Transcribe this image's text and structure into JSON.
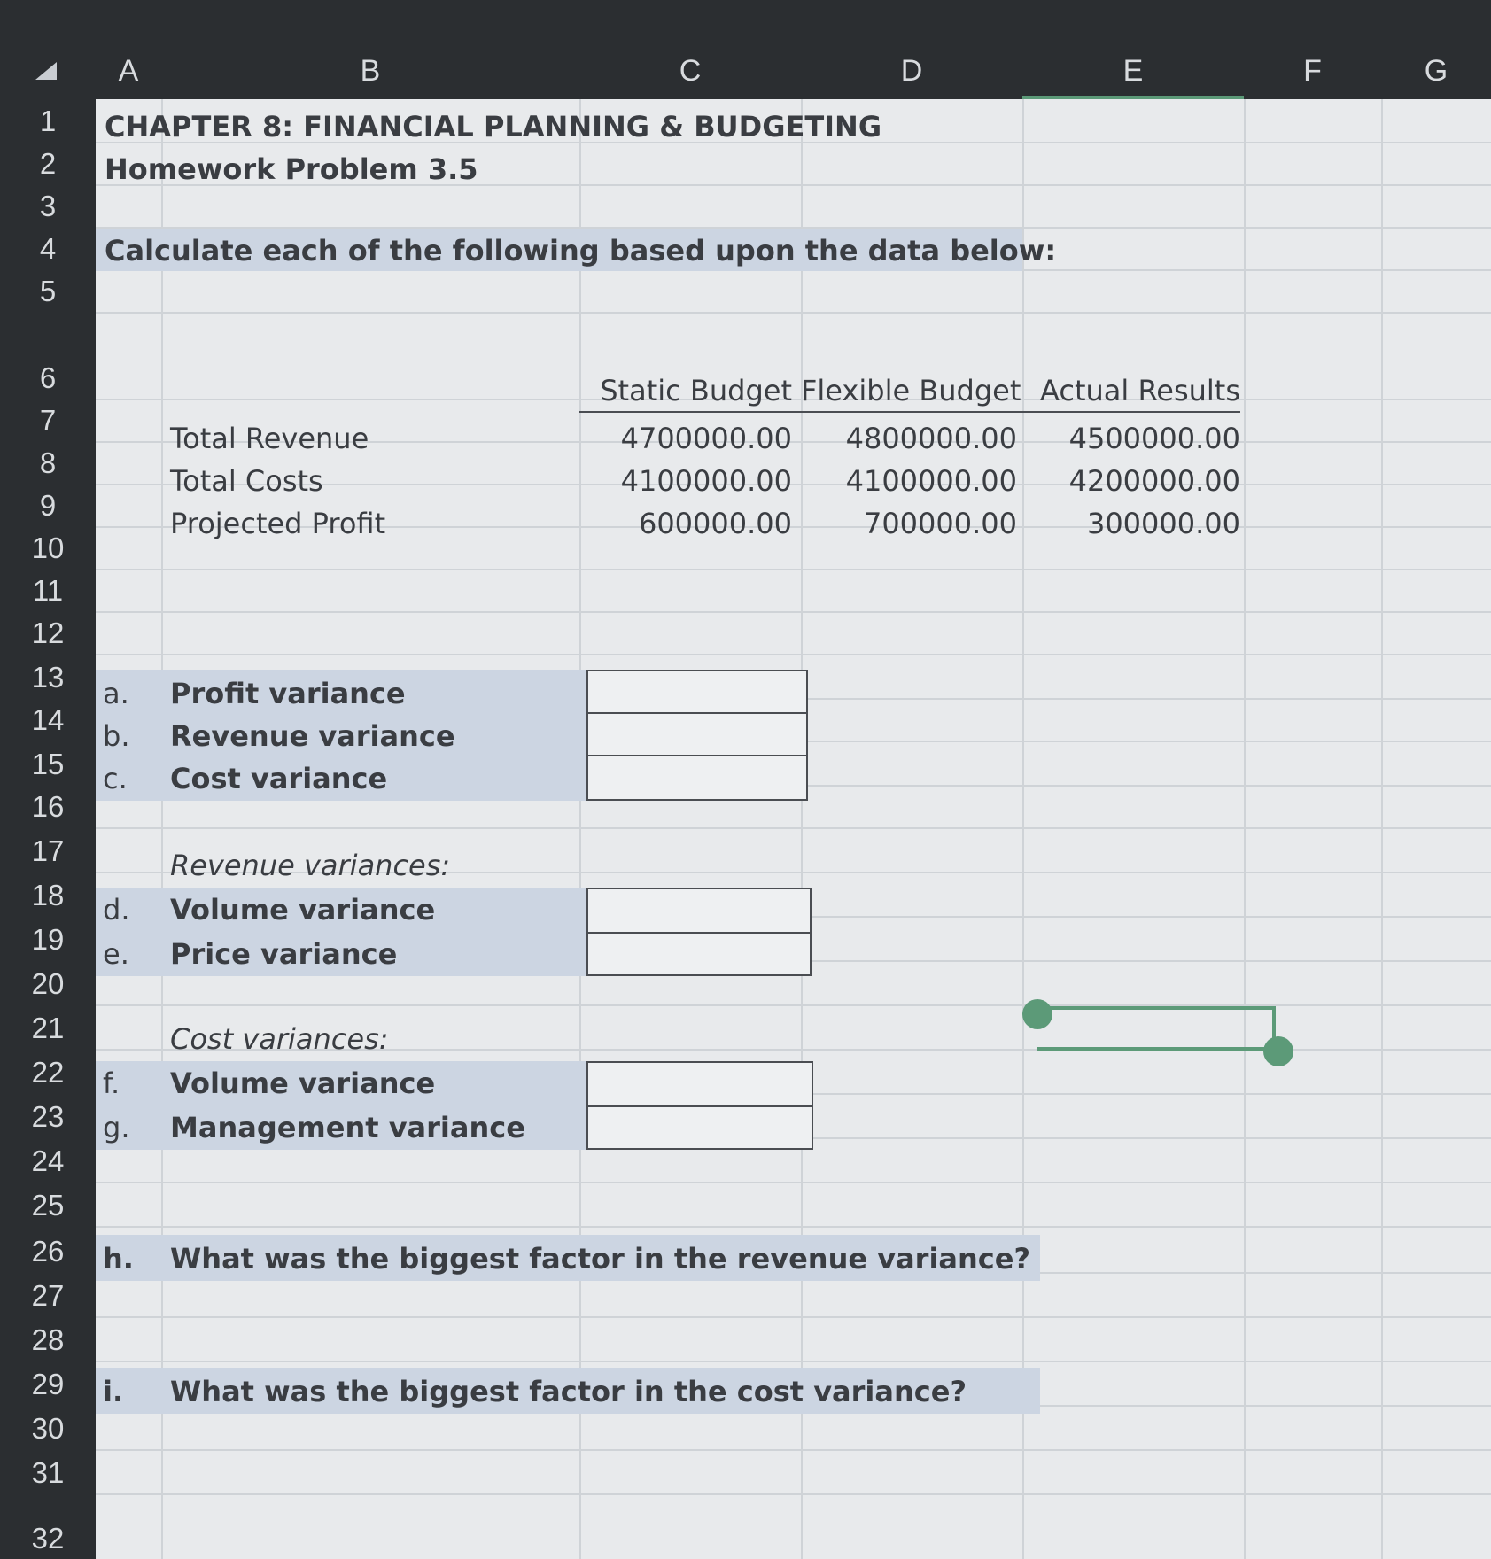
{
  "columns": [
    "A",
    "B",
    "C",
    "D",
    "E",
    "F",
    "G"
  ],
  "rows": [
    "1",
    "2",
    "3",
    "4",
    "5",
    "6",
    "7",
    "8",
    "9",
    "10",
    "11",
    "12",
    "13",
    "14",
    "15",
    "16",
    "17",
    "18",
    "19",
    "20",
    "21",
    "22",
    "23",
    "24",
    "25",
    "26",
    "27",
    "28",
    "29",
    "30",
    "31",
    "32"
  ],
  "title": "CHAPTER 8: FINANCIAL PLANNING & BUDGETING",
  "subtitle": "Homework Problem 3.5",
  "instruction": "Calculate each of the following based upon the data below:",
  "table": {
    "headers": [
      "Static Budget",
      "Flexible Budget",
      "Actual Results"
    ],
    "rows": [
      {
        "label": "Total Revenue",
        "values": [
          "4700000.00",
          "4800000.00",
          "4500000.00"
        ]
      },
      {
        "label": "Total Costs",
        "values": [
          "4100000.00",
          "4100000.00",
          "4200000.00"
        ]
      },
      {
        "label": "Projected Profit",
        "values": [
          "600000.00",
          "700000.00",
          "300000.00"
        ]
      }
    ]
  },
  "questions": {
    "a": {
      "letter": "a.",
      "label": "Profit variance",
      "answer": ""
    },
    "b": {
      "letter": "b.",
      "label": "Revenue variance",
      "answer": ""
    },
    "c": {
      "letter": "c.",
      "label": "Cost variance",
      "answer": ""
    },
    "revenue_heading": "Revenue variances:",
    "d": {
      "letter": "d.",
      "label": "Volume variance",
      "answer": ""
    },
    "e": {
      "letter": "e.",
      "label": "Price variance",
      "answer": ""
    },
    "cost_heading": "Cost variances:",
    "f": {
      "letter": "f.",
      "label": "Volume variance",
      "answer": ""
    },
    "g": {
      "letter": "g.",
      "label": "Management variance",
      "answer": ""
    },
    "h": {
      "letter": "h.",
      "label": "What was the biggest factor in the revenue variance?"
    },
    "i": {
      "letter": "i.",
      "label": "What was the biggest factor in the cost variance?"
    }
  },
  "colors": {
    "accent": "#5c9a78",
    "shade": "#ccd5e2",
    "grid_bg": "#e8eaec"
  }
}
